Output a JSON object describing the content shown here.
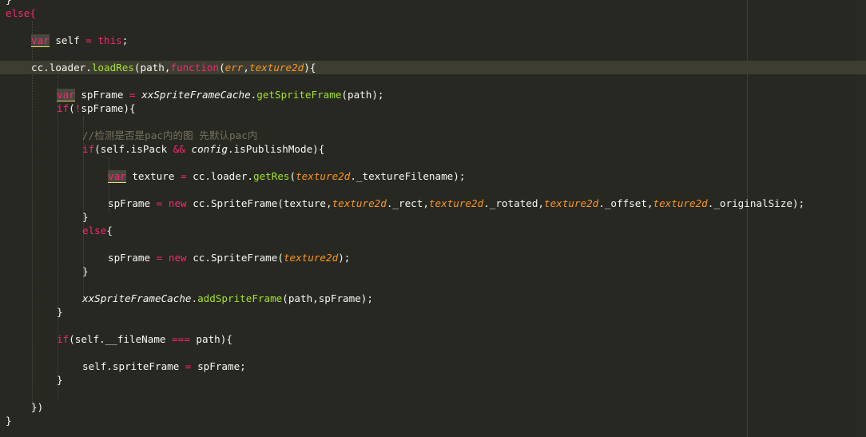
{
  "editor": {
    "theme": {
      "background": "#272822",
      "keyword": "#f92672",
      "function": "#a6e22e",
      "param": "#fd971f",
      "comment": "#75715e",
      "text": "#f8f8f2",
      "storage": "#66d9ef"
    },
    "lines": {
      "l0": [
        "}"
      ],
      "l1": [
        "else{"
      ],
      "l2": [
        "var",
        " self ",
        "=",
        " ",
        "this",
        ";"
      ],
      "l3": [
        "cc.loader.",
        "loadRes",
        "(path,",
        "function",
        "(",
        "err",
        ",",
        "texture2d",
        "){"
      ],
      "l4": [
        "var",
        " spFrame ",
        "=",
        " ",
        "xxSpriteFrameCache",
        ".",
        "getSpriteFrame",
        "(path);"
      ],
      "l5": [
        "if",
        "(",
        "!",
        "spFrame){"
      ],
      "l6": [
        "//检测是否是pac内的图 先默认pac内"
      ],
      "l7": [
        "if",
        "(self.isPack ",
        "&&",
        " ",
        "config",
        ".isPublishMode){"
      ],
      "l8": [
        "var",
        " texture ",
        "=",
        " cc.loader.",
        "getRes",
        "(",
        "texture2d",
        "._textureFilename);"
      ],
      "l9": [
        "spFrame ",
        "=",
        " ",
        "new",
        " cc.SpriteFrame(texture,",
        "texture2d",
        "._rect,",
        "texture2d",
        "._rotated,",
        "texture2d",
        "._offset,",
        "texture2d",
        "._originalSize);"
      ],
      "l10": [
        "}"
      ],
      "l11": [
        "else",
        "{"
      ],
      "l12": [
        "spFrame ",
        "=",
        " ",
        "new",
        " cc.SpriteFrame(",
        "texture2d",
        ");"
      ],
      "l13": [
        "}"
      ],
      "l14": [
        "xxSpriteFrameCache",
        ".",
        "addSpriteFrame",
        "(path,spFrame);"
      ],
      "l15": [
        "}"
      ],
      "l16": [
        "if",
        "(self.__fileName ",
        "===",
        " path){"
      ],
      "l17": [
        "self.spriteFrame ",
        "=",
        " spFrame;"
      ],
      "l18": [
        "}"
      ],
      "l19": [
        "})"
      ],
      "l20": [
        "}"
      ]
    }
  }
}
